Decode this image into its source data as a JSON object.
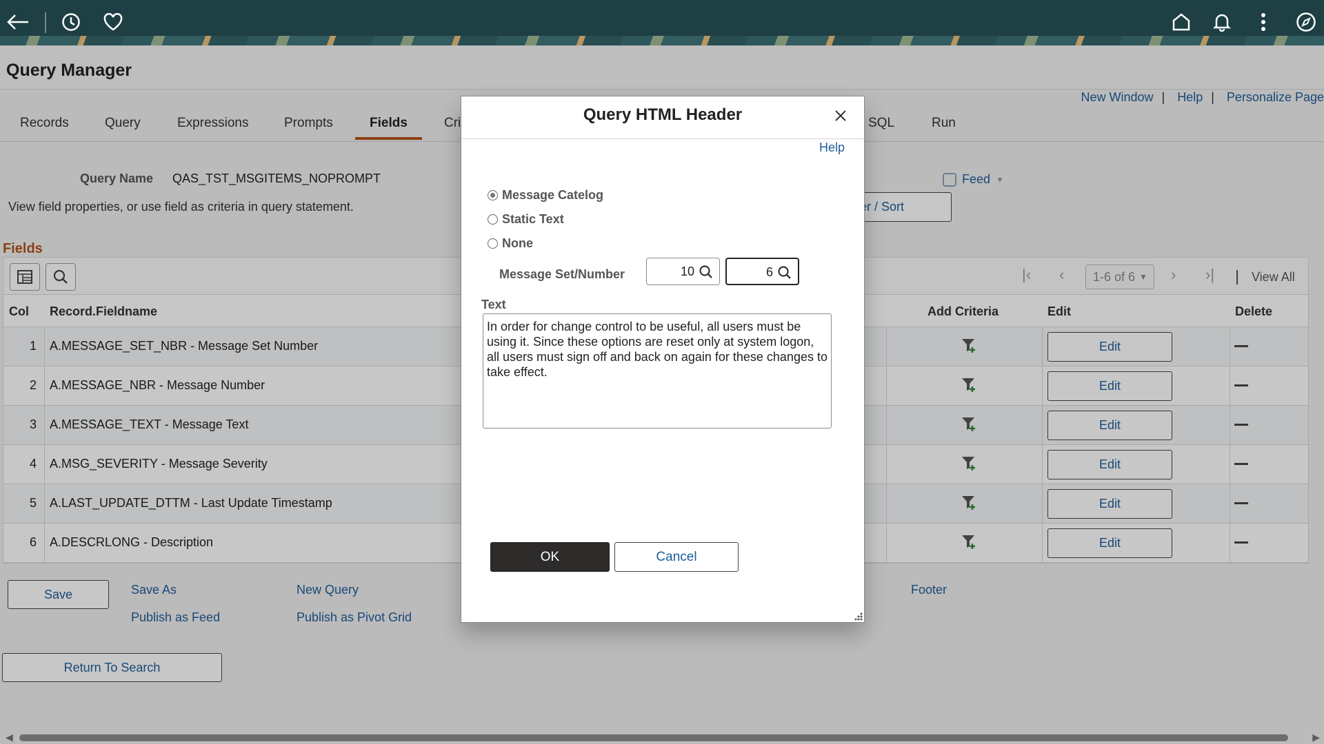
{
  "nav": {
    "icons": [
      "back-arrow-icon",
      "history-icon",
      "favorites-heart-icon",
      "home-icon",
      "notifications-bell-icon",
      "more-vertical-icon",
      "navigator-compass-icon"
    ]
  },
  "header": {
    "title": "Query Manager",
    "links": [
      "New Window",
      "Help",
      "Personalize Page"
    ]
  },
  "tabs": [
    "Records",
    "Query",
    "Expressions",
    "Prompts",
    "Fields",
    "Cri",
    "SQL",
    "Run"
  ],
  "active_tab": "Fields",
  "query": {
    "name_label": "Query Name",
    "name_value": "QAS_TST_MSGITEMS_NOPROMPT",
    "instruction": "View field properties, or use field as criteria in query statement.",
    "feed_label": "Feed",
    "filter_sort_label": "er / Sort"
  },
  "fields_grid": {
    "title": "Fields",
    "pager_text": "1-6 of 6",
    "view_all": "View All",
    "columns": [
      "Col",
      "Record.Fieldname",
      "Add Criteria",
      "Edit",
      "Delete"
    ],
    "edit_label": "Edit",
    "rows": [
      {
        "col": "1",
        "field": "A.MESSAGE_SET_NBR - Message Set Number"
      },
      {
        "col": "2",
        "field": "A.MESSAGE_NBR - Message Number"
      },
      {
        "col": "3",
        "field": "A.MESSAGE_TEXT - Message Text"
      },
      {
        "col": "4",
        "field": "A.MSG_SEVERITY - Message Severity"
      },
      {
        "col": "5",
        "field": "A.LAST_UPDATE_DTTM - Last Update Timestamp"
      },
      {
        "col": "6",
        "field": "A.DESCRLONG - Description"
      }
    ]
  },
  "actions": {
    "save": "Save",
    "save_as": "Save As",
    "new_query": "New Query",
    "footer": "Footer",
    "publish_feed": "Publish as Feed",
    "publish_pivot": "Publish as Pivot Grid",
    "return_to_search": "Return To Search"
  },
  "modal": {
    "title": "Query HTML Header",
    "help": "Help",
    "radio_options": [
      {
        "label": "Message Catelog",
        "selected": true
      },
      {
        "label": "Static Text",
        "selected": false
      },
      {
        "label": "None",
        "selected": false
      }
    ],
    "msg_set_label": "Message Set/Number",
    "msg_set_value": "10",
    "msg_number_value": "6",
    "text_label": "Text",
    "text_value": "In order for change control to be useful, all users must be using it.  Since these options are reset only at system logon, all users must sign off and back on again for these changes to take effect.",
    "ok": "OK",
    "cancel": "Cancel"
  },
  "colors": {
    "nav_bg": "#1e3f44",
    "link": "#1f5d99",
    "accent": "#b35219",
    "ok_bg": "#2e2b2b"
  }
}
